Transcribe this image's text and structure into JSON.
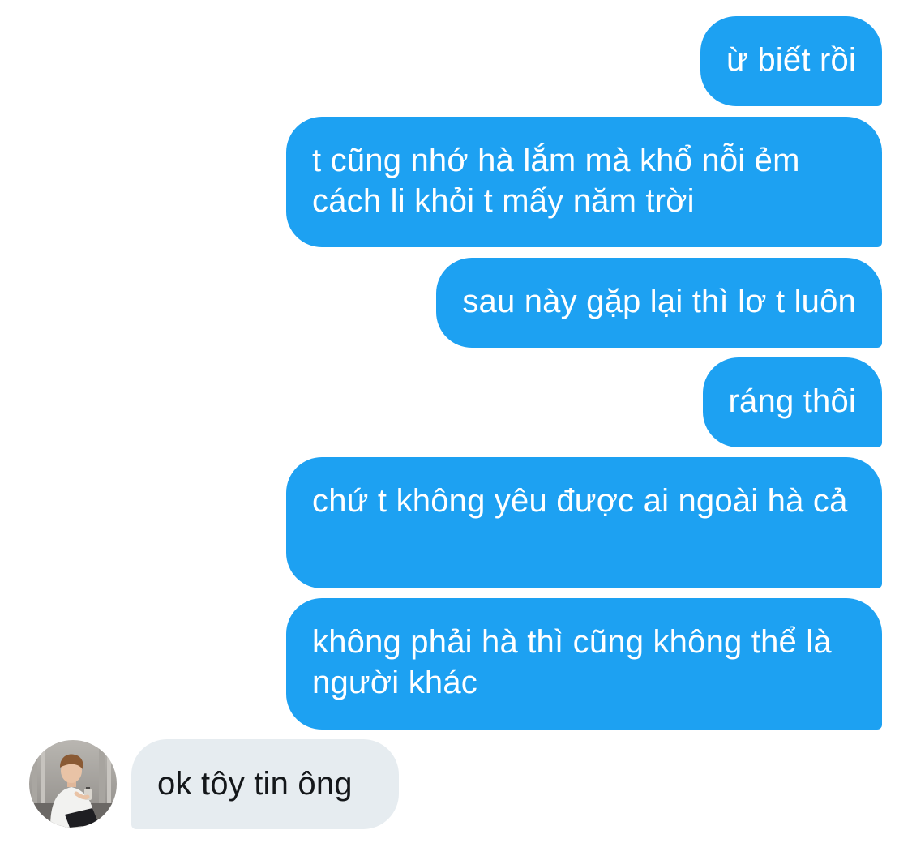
{
  "messages": [
    {
      "side": "sent",
      "text": "ừ biết rồi"
    },
    {
      "side": "sent",
      "text": "t cũng nhớ hà lắm mà khổ nỗi ẻm cách li khỏi t mấy năm trời"
    },
    {
      "side": "sent",
      "text": "sau này gặp lại thì lơ t luôn"
    },
    {
      "side": "sent",
      "text": "ráng thôi"
    },
    {
      "side": "sent",
      "text": "chứ t không yêu được ai ngoài hà cả"
    },
    {
      "side": "sent",
      "text": "không phải hà thì cũng không thể là người khác"
    },
    {
      "side": "received",
      "text": "ok tôy tin ông"
    }
  ],
  "colors": {
    "sent_bubble": "#1da1f2",
    "received_bubble": "#e6ecf0"
  },
  "icons": {
    "avatar": "user-avatar"
  }
}
